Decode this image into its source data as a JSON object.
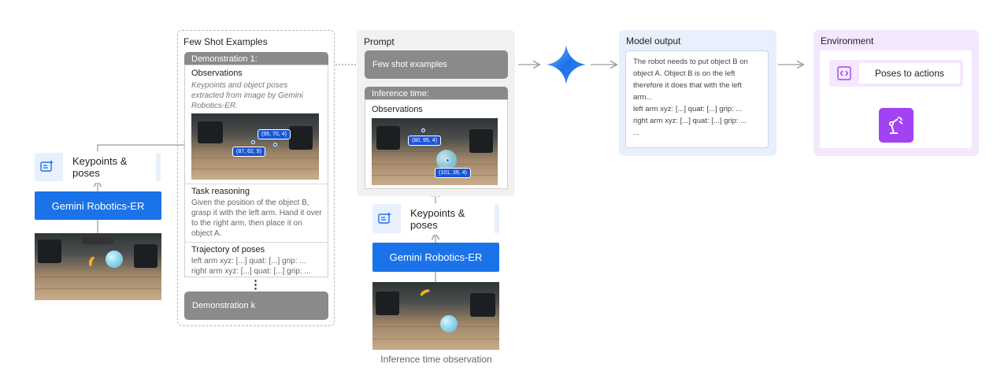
{
  "left": {
    "chip_label": "Keypoints & poses",
    "button_label": "Gemini Robotics-ER"
  },
  "few_shot": {
    "title": "Few Shot Examples",
    "demo1_header": "Demonstration 1:",
    "observations_title": "Observations",
    "observations_desc": "Keypoints and object poses extracted from image by Gemini Robotics-ER.",
    "keypoints": [
      "(95, 70, 4)",
      "(87, 62, 9)"
    ],
    "task_reasoning_title": "Task reasoning",
    "task_reasoning_text": "Given the position of the object B, grasp it with the left arm. Hand it over to the right arm, then place it on object A.",
    "trajectory_title": "Trajectory of poses",
    "trajectory_lines": [
      "left arm xyz: [...] quat: [...] grip: ...",
      "right arm xyz: [...] quat: [...] grip: ..."
    ],
    "ellipsis": "⋮",
    "demo_k": "Demonstration k"
  },
  "prompt": {
    "title": "Prompt",
    "few_shot_pill": "Few shot examples",
    "inference_header": "Inference time:",
    "observations_title": "Observations",
    "keypoints": [
      "(80, 95, 4)",
      "(101, 39, 4)"
    ]
  },
  "middle": {
    "chip_label": "Keypoints & poses",
    "button_label": "Gemini Robotics-ER",
    "caption": "Inference time observation"
  },
  "model_output": {
    "title": "Model output",
    "lines": [
      "The robot needs to put object B on",
      "object A. Object B is on the left",
      "therefore it does that with the left",
      "arm...",
      "left arm xyz: [...] quat: [...] grip: ...",
      "right arm xyz: [...] quat: [...] grip: ...",
      "..."
    ]
  },
  "environment": {
    "title": "Environment",
    "chip_label": "Poses to actions"
  },
  "colors": {
    "google_blue": "#1a73e8",
    "light_blue": "#e8f0fe",
    "purple": "#a142f4",
    "light_purple": "#f3e8fd",
    "gray_header": "#8a8a8a"
  },
  "icons": {
    "chip": "sparkle-list-icon",
    "env_chip": "code-brackets-icon",
    "robot": "robot-arm-icon",
    "gemini": "gemini-sparkle-icon"
  }
}
